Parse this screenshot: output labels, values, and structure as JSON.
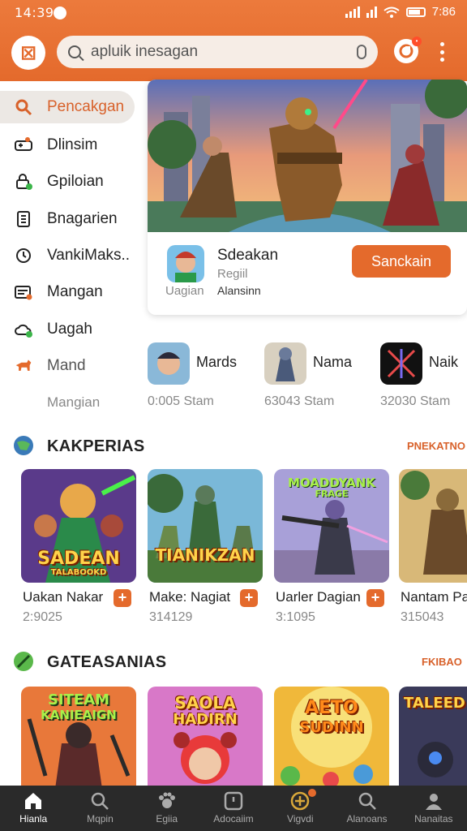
{
  "status": {
    "time": "14:39",
    "right_time": "7:86"
  },
  "search": {
    "placeholder": "apluik inesagan"
  },
  "sidebar": {
    "items": [
      {
        "label": "Pencakgan",
        "icon": "search-icon",
        "active": true
      },
      {
        "label": "Dlinsim",
        "icon": "gamepad-icon"
      },
      {
        "label": "Gpiloian",
        "icon": "lock-icon"
      },
      {
        "label": "Bnagarien",
        "icon": "document-icon"
      },
      {
        "label": "VankiMaks..",
        "icon": "clock-icon"
      },
      {
        "label": "Mangan",
        "icon": "card-icon"
      },
      {
        "label": "Uagah",
        "icon": "cloud-icon"
      },
      {
        "label": "Mand",
        "icon": "dog-icon"
      }
    ],
    "extra_label": "Mangian"
  },
  "featured": {
    "title": "Sdeakan",
    "subtitle": "Regiil",
    "label": "Uagian",
    "meta": "Alansinn",
    "button": "Sanckain"
  },
  "mini_apps": [
    {
      "name": "Mards",
      "count": "0:005 Stam"
    },
    {
      "name": "Nama",
      "count": "63043 Stam"
    },
    {
      "name": "Naik",
      "count": "32030 Stam"
    }
  ],
  "section1": {
    "title": "KAKPERIAS",
    "more": "PNEKATNO",
    "cards": [
      {
        "name": "Uakan Nakar",
        "count": "2:9025",
        "art_text": "SADEAN",
        "art_sub": "TALABOOKD"
      },
      {
        "name": "Make: Nagiat",
        "count": "314129",
        "art_text": "TIANIKZAN",
        "art_sub": ""
      },
      {
        "name": "Uarler Dagian",
        "count": "3:1095",
        "art_text": "MOADDYANK",
        "art_sub": "FRAGE"
      },
      {
        "name": "Nantam Par",
        "count": "315043",
        "art_text": "",
        "art_sub": ""
      }
    ]
  },
  "section2": {
    "title": "GATEASANIAS",
    "more": "FKIBAO",
    "cards": [
      {
        "art_text": "SITEAM",
        "art_sub": "KANIEAIGN"
      },
      {
        "art_text": "SAOLA",
        "art_sub": "HADIRN"
      },
      {
        "art_text": "AETO",
        "art_sub": "SUDINN"
      },
      {
        "art_text": "TALEED",
        "art_sub": ""
      }
    ]
  },
  "bottom_nav": [
    {
      "label": "Hianla",
      "icon": "home-icon",
      "active": true
    },
    {
      "label": "Mqpin",
      "icon": "search-icon"
    },
    {
      "label": "Egiia",
      "icon": "paw-icon"
    },
    {
      "label": "Adocaiim",
      "icon": "square-icon"
    },
    {
      "label": "Vigvdi",
      "icon": "gamepad-icon",
      "badge": true
    },
    {
      "label": "Alanoans",
      "icon": "search-icon"
    },
    {
      "label": "Nanaitas",
      "icon": "profile-icon"
    }
  ],
  "colors": {
    "accent": "#e46a2c",
    "nav_bg": "#2a2a2a"
  }
}
